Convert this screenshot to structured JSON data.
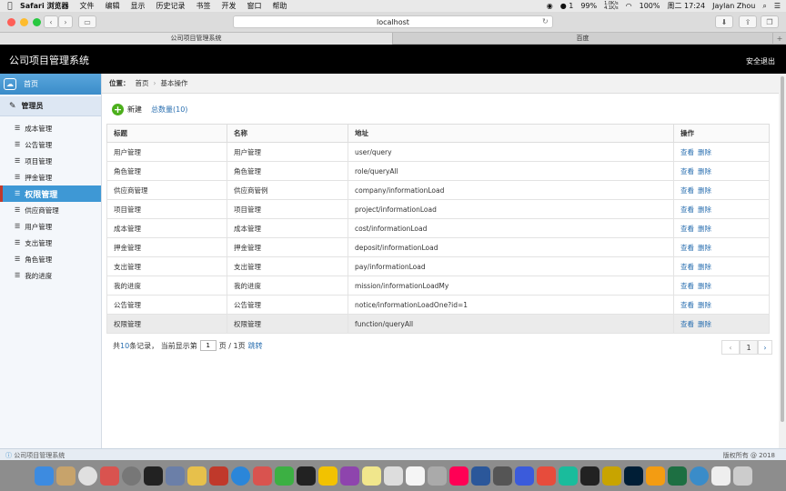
{
  "menubar": {
    "app": "Safari 浏览器",
    "items": [
      "文件",
      "编辑",
      "显示",
      "历史记录",
      "书签",
      "开发",
      "窗口",
      "帮助"
    ],
    "status": {
      "battery": "99%",
      "net_up": "1.0K/s",
      "net_down": "4.1K/s",
      "notif": "1",
      "batt2": "100%",
      "clock": "周二 17:24",
      "user": "Jaylan Zhou"
    }
  },
  "browser": {
    "address": "localhost",
    "tabs": [
      {
        "label": "公司项目管理系统",
        "active": true
      },
      {
        "label": "百度",
        "active": false
      }
    ]
  },
  "header": {
    "title": "公司项目管理系统",
    "logout": "安全退出"
  },
  "sidebar": {
    "home": "首页",
    "group": "管理员",
    "items": [
      {
        "label": "成本管理"
      },
      {
        "label": "公告管理"
      },
      {
        "label": "项目管理"
      },
      {
        "label": "押金管理"
      },
      {
        "label": "权限管理",
        "active": true
      },
      {
        "label": "供应商管理"
      },
      {
        "label": "用户管理"
      },
      {
        "label": "支出管理"
      },
      {
        "label": "角色管理"
      },
      {
        "label": "我的进度"
      }
    ]
  },
  "breadcrumb": {
    "prefix": "位置：",
    "home": "首页",
    "sep": "›",
    "current": "基本操作"
  },
  "actions": {
    "new_label": "新建",
    "total_label": "总数量(10)"
  },
  "table": {
    "headers": [
      "标题",
      "名称",
      "地址",
      "操作"
    ],
    "view_label": "查看",
    "delete_label": "删除",
    "rows": [
      {
        "title": "用户管理",
        "name": "用户管理",
        "url": "user/query"
      },
      {
        "title": "角色管理",
        "name": "角色管理",
        "url": "role/queryAll"
      },
      {
        "title": "供应商管理",
        "name": "供应商管例",
        "url": "company/informationLoad"
      },
      {
        "title": "项目管理",
        "name": "项目管理",
        "url": "project/informationLoad"
      },
      {
        "title": "成本管理",
        "name": "成本管理",
        "url": "cost/informationLoad"
      },
      {
        "title": "押金管理",
        "name": "押金管理",
        "url": "deposit/informationLoad"
      },
      {
        "title": "支出管理",
        "name": "支出管理",
        "url": "pay/informationLoad"
      },
      {
        "title": "我的进度",
        "name": "我的进度",
        "url": "mission/informationLoadMy"
      },
      {
        "title": "公告管理",
        "name": "公告管理",
        "url": "notice/informationLoadOne?id=1"
      },
      {
        "title": "权限管理",
        "name": "权限管理",
        "url": "function/queryAll"
      }
    ]
  },
  "pager": {
    "prefix": "共",
    "count": "10",
    "suffix": "条记录，  当前显示第",
    "page_value": "1",
    "page_of": "页 / 1页",
    "go": "跳转",
    "prev": "‹",
    "current": "1",
    "next": "›"
  },
  "footer": {
    "left": "公司项目管理系统",
    "right": "版权所有 @ 2018"
  }
}
